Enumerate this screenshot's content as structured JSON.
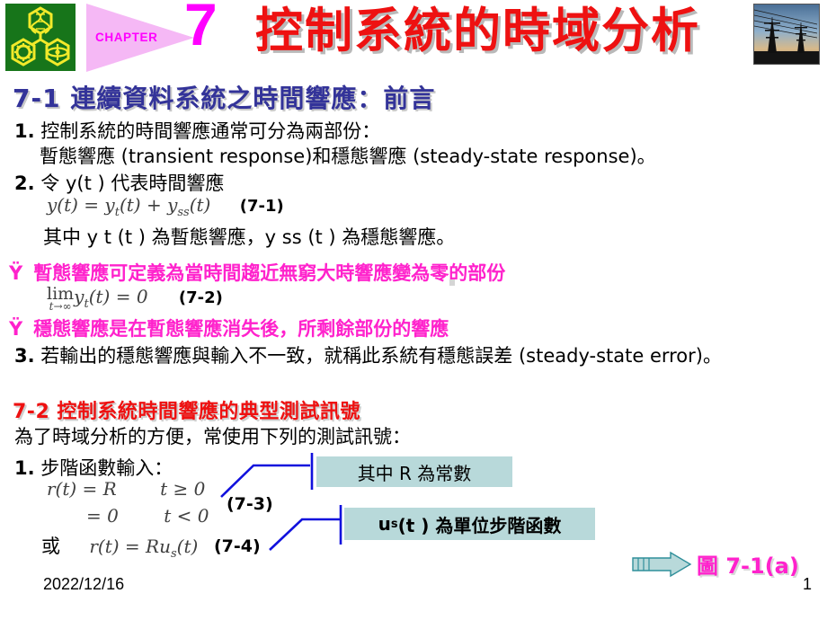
{
  "header": {
    "logo_alt": "university-crest",
    "chapter_word": "CHAPTER",
    "chapter_number": "7",
    "title": "控制系統的時域分析",
    "photo_alt": "power-transmission-towers-at-sunset"
  },
  "sections": {
    "heading_7_1": "7-1  連續資料系統之時間響應：前言",
    "heading_7_2": "7-2  控制系統時間響應的典型測試訊號"
  },
  "body": {
    "item1_lead": "1.",
    "item1_line1": "控制系統的時間響應通常可分為兩部份：",
    "item1_line2": "暫態響應 (transient response)和穩態響應 (steady-state response)。",
    "item2_lead": "2.",
    "item2_text": "令 y(t ) 代表時間響應",
    "eq_7_1": "y(t) = y",
    "eq_7_1_sub1": "t",
    "eq_7_1_mid": "(t) + y",
    "eq_7_1_sub2": "ss",
    "eq_7_1_end": "(t)",
    "eq_7_1_tag": "(7-1)",
    "mid_line": "其中 y t (t ) 為暫態響應，y ss (t ) 為穩態響應。",
    "bullet_glyph": "Ÿ",
    "bullet1_text": "暫態響應可定義為當時間趨近無窮大時響應變為零的部份",
    "eq_7_2_lim": "lim",
    "eq_7_2_sub": "t→∞",
    "eq_7_2_body": "y",
    "eq_7_2_bodysub": "t",
    "eq_7_2_rest": "(t) = 0",
    "eq_7_2_tag": "(7-2)",
    "bullet2_text": "穩態響應是在暫態響應消失後，所剩餘部份的響應",
    "item3_lead": "3.",
    "item3_text": "若輸出的穩態響應與輸入不一致，就稱此系統有穩態誤差 (steady-state error)。",
    "intro_7_2": "為了時域分析的方便，常使用下列的測試訊號：",
    "item_step_lead": "1.",
    "item_step_text": "步階函數輸入：",
    "eq_7_3_line1_lhs": "r(t) = R",
    "eq_7_3_line1_rhs": "t ≥ 0",
    "eq_7_3_line2_lhs": "= 0",
    "eq_7_3_line2_rhs": "t < 0",
    "eq_7_3_tag": "(7-3)",
    "eq_7_4_prefix": "或",
    "eq_7_4_body": "r(t) = Ru",
    "eq_7_4_sub": "s",
    "eq_7_4_end": "(t)",
    "eq_7_4_tag": "(7-4)"
  },
  "callouts": {
    "box1": "其中 R 為常數",
    "box2_main": "u",
    "box2_sub": "s",
    "box2_rest": "(t ) 為單位步階函數"
  },
  "footer": {
    "figure_label": "圖 7-1(a)",
    "date": "2022/12/16",
    "page_number": "1"
  },
  "colors": {
    "title_red": "#ee1111",
    "heading_blue": "#333399",
    "magenta": "#ff00ff",
    "bullet_magenta": "#ff22cc",
    "callout_cyan": "#b8d9da",
    "leader_blue": "#1111dd",
    "logo_green": "#17751a",
    "chapter_tri_pink": "#f5b8f5"
  }
}
